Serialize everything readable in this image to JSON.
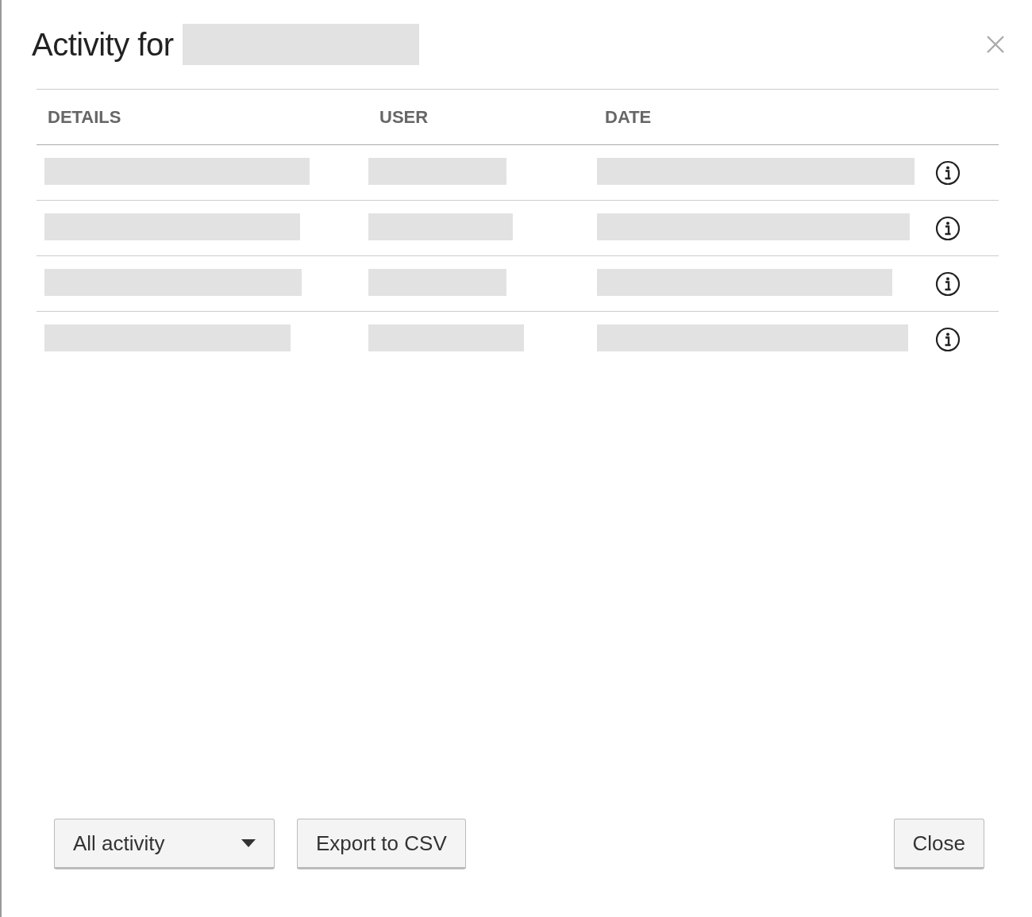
{
  "dialog": {
    "title": "Activity for",
    "title_suffix": {
      "kind": "redacted"
    }
  },
  "table": {
    "columns": [
      "DETAILS",
      "USER",
      "DATE"
    ],
    "rows": [
      {
        "cells": [
          {
            "kind": "redacted"
          },
          {
            "kind": "redacted"
          },
          {
            "kind": "redacted"
          }
        ],
        "info": true
      },
      {
        "cells": [
          {
            "kind": "redacted"
          },
          {
            "kind": "redacted"
          },
          {
            "kind": "redacted"
          }
        ],
        "info": true
      },
      {
        "cells": [
          {
            "kind": "redacted"
          },
          {
            "kind": "redacted"
          },
          {
            "kind": "redacted"
          }
        ],
        "info": true
      },
      {
        "cells": [
          {
            "kind": "redacted"
          },
          {
            "kind": "redacted"
          },
          {
            "kind": "redacted"
          }
        ],
        "info": true
      }
    ]
  },
  "footer": {
    "filter": {
      "value": "All activity"
    },
    "export_button": "Export to CSV",
    "close_button": "Close"
  }
}
